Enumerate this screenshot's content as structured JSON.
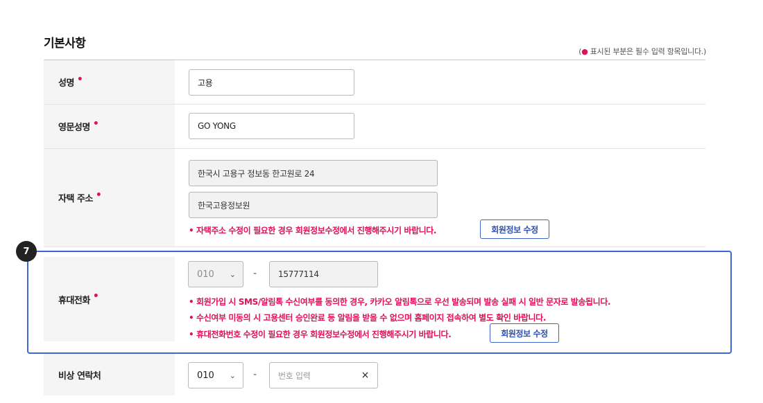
{
  "section": {
    "title": "기본사항",
    "required_note_prefix": "(",
    "required_note_dot": "●",
    "required_note_text": " 표시된 부분은 필수 입력 항목입니다.)"
  },
  "required_mark": "•",
  "fields": {
    "name": {
      "label": "성명",
      "value": "고용"
    },
    "eng_name": {
      "label": "영문성명",
      "value": "GO YONG"
    },
    "address": {
      "label": "자택 주소",
      "line1": "한국시 고용구 정보동 한고원로 24",
      "line2": "한국고용정보원",
      "notice": "• 자택주소 수정이 필요한 경우 회원정보수정에서 진행해주시기 바랍니다.",
      "button": "회원정보 수정"
    },
    "mobile": {
      "label": "휴대전화",
      "prefix": "010",
      "dash": "-",
      "number": "15777114",
      "notice1": "• 회원가입 시 SMS/알림톡 수신여부를 동의한 경우, 카카오 알림톡으로 우선 발송되며 발송 실패 시 일반 문자로 발송됩니다.",
      "notice2": "• 수신여부 미동의 시 고용센터 승인완료 등 알림을 받을 수 없으며 홈페이지 접속하여 별도 확인 바랍니다.",
      "notice3": "• 휴대전화번호 수정이 필요한 경우 회원정보수정에서 진행해주시기 바랍니다.",
      "button": "회원정보 수정"
    },
    "emergency": {
      "label": "비상 연락처",
      "prefix": "010",
      "dash": "-",
      "placeholder": "번호 입력",
      "clear": "×"
    }
  },
  "step_badge": "7",
  "icons": {
    "chevron": "⌄"
  }
}
